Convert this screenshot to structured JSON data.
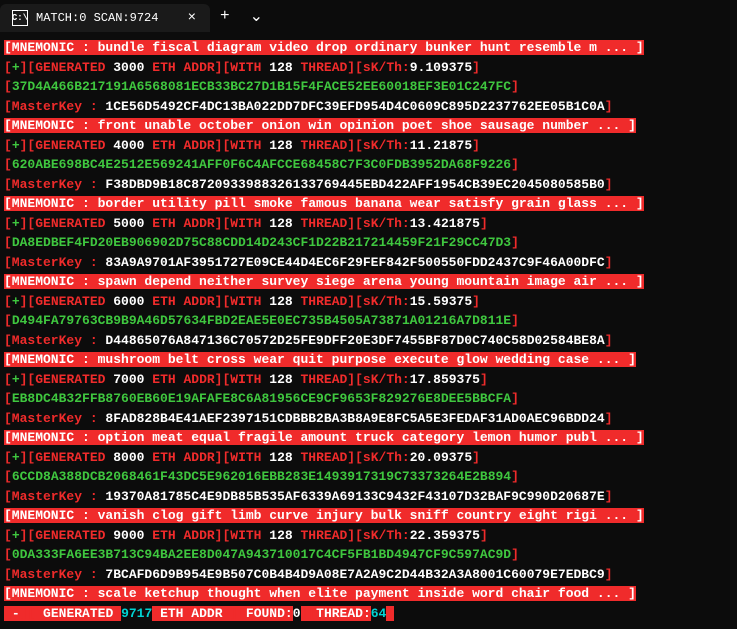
{
  "window": {
    "title": "MATCH:0 SCAN:9724",
    "close": "×",
    "new_tab": "+",
    "dropdown": "⌄"
  },
  "blocks": [
    {
      "mnemonic": "bundle fiscal diagram video drop ordinary bunker hunt resemble m ...",
      "generated": "3000",
      "thread": "128",
      "skth": "9.109375",
      "hash": "37D4A466B217191A6568081ECB33BC27D1B15F4FACE52EE60018EF3E01C247FC",
      "master": "1CE56D5492CF4DC13BA022DD7DFC39EFD954D4C0609C895D2237762EE05B1C0A"
    },
    {
      "mnemonic": "front unable october onion win opinion poet shoe sausage number  ...",
      "generated": "4000",
      "thread": "128",
      "skth": "11.21875",
      "hash": "620ABE698BC4E2512E569241AFF0F6C4AFCCE68458C7F3C0FDB3952DA68F9226",
      "master": "F38DBD9B18C8720933988326133769445EBD422AFF1954CB39EC2045080585B0"
    },
    {
      "mnemonic": "border utility pill smoke famous banana wear satisfy grain glass ...",
      "generated": "5000",
      "thread": "128",
      "skth": "13.421875",
      "hash": "DA8EDBEF4FD20EB906902D75C88CDD14D243CF1D22B217214459F21F29CC47D3",
      "master": "83A9A9701AF3951727E09CE44D4EC6F29FEF842F500550FDD2437C9F46A00DFC"
    },
    {
      "mnemonic": "spawn depend neither survey siege arena young mountain image air ...",
      "generated": "6000",
      "thread": "128",
      "skth": "15.59375",
      "hash": "D494FA79763CB9B9A46D57634FBD2EAE5E0EC735B4505A73871A01216A7D811E",
      "master": "D44865076A847136C70572D25FE9DFF20E3DF7455BF87D0C740C58D02584BE8A"
    },
    {
      "mnemonic": "mushroom belt cross wear quit purpose execute glow wedding case  ...",
      "generated": "7000",
      "thread": "128",
      "skth": "17.859375",
      "hash": "EB8DC4B32FFB8760EB60E19AFAFE8C6A81956CE9CF9653F829276E8DEE5BBCFA",
      "master": "8FAD828B4E41AEF2397151CDBBB2BA3B8A9E8FC5A5E3FEDAF31AD0AEC96BDD24"
    },
    {
      "mnemonic": "option meat equal fragile amount truck category lemon humor publ ...",
      "generated": "8000",
      "thread": "128",
      "skth": "20.09375",
      "hash": "6CCD8A388DCB2068461F43DC5E962016EBB283E1493917319C73373264E2B894",
      "master": "19370A81785C4E9DB85B535AF6339A69133C9432F43107D32BAF9C990D20687E"
    },
    {
      "mnemonic": "vanish clog gift limb curve injury bulk sniff country eight rigi ...",
      "generated": "9000",
      "thread": "128",
      "skth": "22.359375",
      "hash": "0DA333FA6EE3B713C94BA2EE8D047A943710017C4CF5FB1BD4947CF9C597AC9D",
      "master": "7BCAFD6D9B954E9B507C0B4B4D9A08E7A2A9C2D44B32A3A8001C60079E7EDBC9"
    }
  ],
  "last": {
    "mnemonic": "scale ketchup thought when elite payment inside word chair food  ..."
  },
  "footer": {
    "generated": "9717",
    "found": "0",
    "thread": "64"
  },
  "labels": {
    "mnemonic": "MNEMONIC :",
    "generated_open": "[",
    "plus": "+",
    "generated": "GENERATED",
    "eth_addr": "ETH ADDR",
    "with": "WITH",
    "thread": "THREAD",
    "skth": "sK/Th:",
    "masterkey": "MasterKey :",
    "found": "FOUND:",
    "minus": "-",
    "close": "]",
    "pipe": "]["
  }
}
